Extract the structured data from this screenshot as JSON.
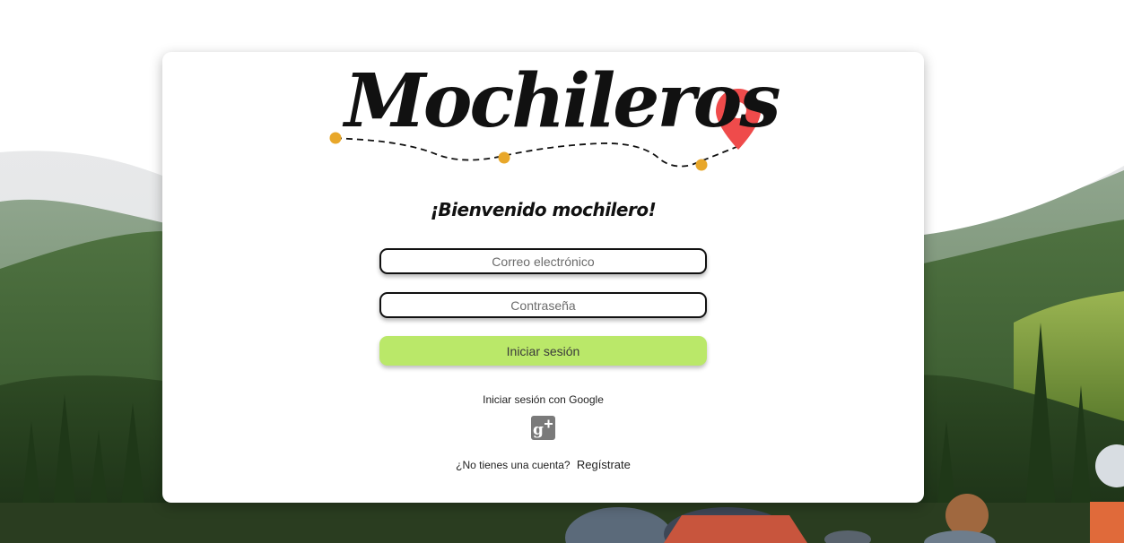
{
  "brand": {
    "name": "Mochileros",
    "accent_dot_color": "#e8a72a",
    "pin_color": "#ef4b4b"
  },
  "welcome": "¡Bienvenido mochilero!",
  "form": {
    "email_placeholder": "Correo electrónico",
    "password_placeholder": "Contraseña",
    "login_label": "Iniciar sesión",
    "login_button_color": "#bae869"
  },
  "google": {
    "label": "Iniciar sesión con Google",
    "icon": "google-plus-icon"
  },
  "register": {
    "question": "¿No tienes una cuenta?",
    "link": "Regístrate"
  }
}
